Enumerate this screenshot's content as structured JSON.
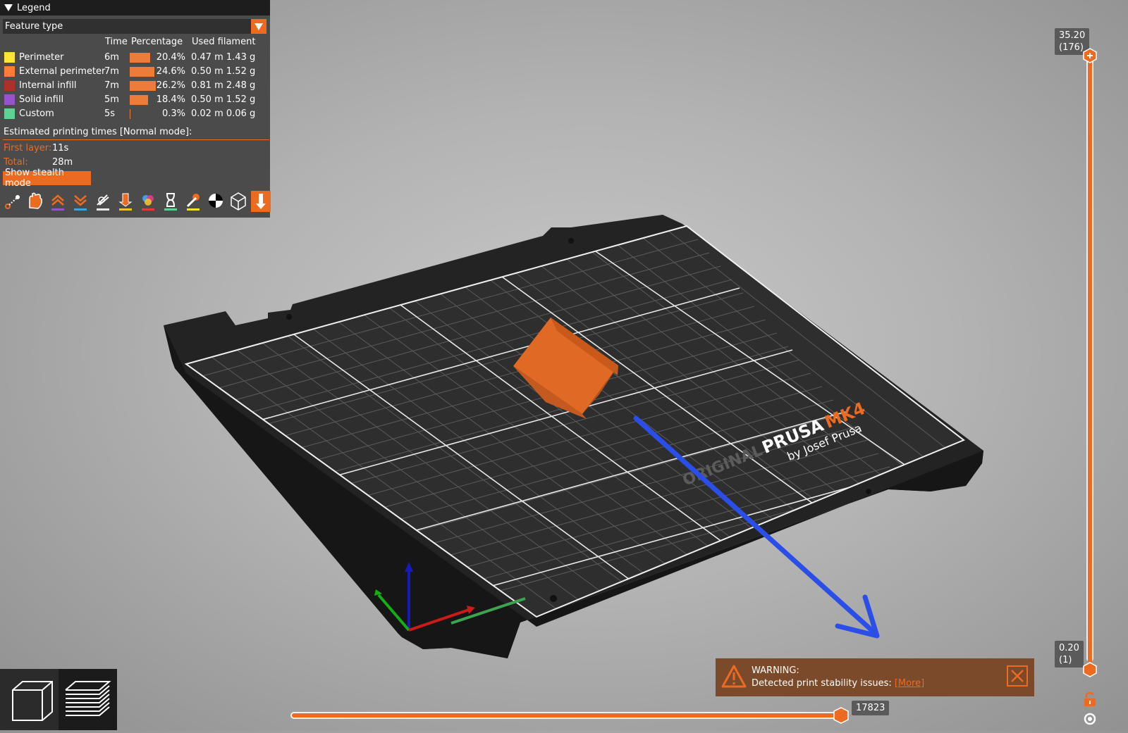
{
  "legend": {
    "title": "Legend",
    "view_type": "Feature type",
    "columns": {
      "time": "Time",
      "percentage": "Percentage",
      "used_filament": "Used filament"
    },
    "features": [
      {
        "name": "Perimeter",
        "time": "6m",
        "percent": "20.4%",
        "percent_value": 20.4,
        "length": "0.47 m",
        "weight": "1.43 g",
        "color": "#FFE633"
      },
      {
        "name": "External perimeter",
        "time": "7m",
        "percent": "24.6%",
        "percent_value": 24.6,
        "length": "0.50 m",
        "weight": "1.52 g",
        "color": "#FF7D38"
      },
      {
        "name": "Internal infill",
        "time": "7m",
        "percent": "26.2%",
        "percent_value": 26.2,
        "length": "0.81 m",
        "weight": "2.48 g",
        "color": "#B03029"
      },
      {
        "name": "Solid infill",
        "time": "5m",
        "percent": "18.4%",
        "percent_value": 18.4,
        "length": "0.50 m",
        "weight": "1.52 g",
        "color": "#9654CC"
      },
      {
        "name": "Custom",
        "time": "5s",
        "percent": "0.3%",
        "percent_value": 0.3,
        "length": "0.02 m",
        "weight": "0.06 g",
        "color": "#5ED194"
      }
    ],
    "estimated_label": "Estimated printing times [Normal mode]:",
    "first_layer_label": "First layer:",
    "first_layer_value": "11s",
    "total_label": "Total:",
    "total_value": "28m",
    "stealth_button": "Show stealth mode",
    "toolbar_icons": [
      "travel-icon",
      "wipe-icon",
      "retractions-icon",
      "deretractions-icon",
      "seams-icon",
      "tool-changes-icon",
      "color-changes-icon",
      "pause-icon",
      "custom-gcode-icon",
      "center-of-gravity-icon",
      "shells-icon",
      "tool-marker-icon"
    ]
  },
  "vertical_slider": {
    "top_value": "35.20",
    "top_layer": "(176)",
    "bottom_value": "0.20",
    "bottom_layer": "(1)"
  },
  "horizontal_slider": {
    "value": "17823"
  },
  "warning": {
    "title": "WARNING:",
    "message": "Detected print stability issues:",
    "more": "[More]"
  },
  "bed": {
    "brand": "ORIGINAL",
    "name": "PRUSA",
    "model": "MK4",
    "maker": "by Josef Prusa"
  },
  "colors": {
    "accent": "#ED6B21",
    "panel": "#4B4B4B"
  }
}
